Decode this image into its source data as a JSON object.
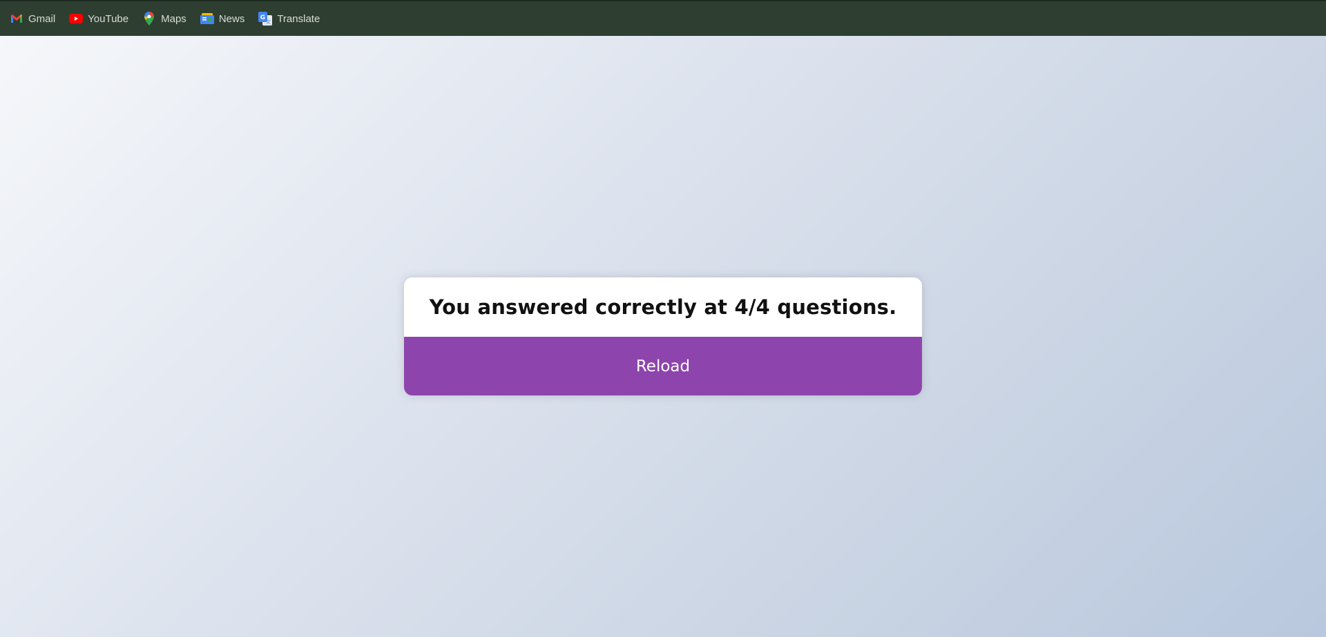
{
  "bookmarks": [
    {
      "label": "Gmail",
      "icon": "gmail-icon"
    },
    {
      "label": "YouTube",
      "icon": "youtube-icon"
    },
    {
      "label": "Maps",
      "icon": "maps-icon"
    },
    {
      "label": "News",
      "icon": "news-icon"
    },
    {
      "label": "Translate",
      "icon": "translate-icon"
    }
  ],
  "quiz": {
    "result_text": "You answered correctly at 4/4 questions.",
    "reload_label": "Reload"
  },
  "colors": {
    "bookmarks_bar": "#2e3f31",
    "button": "#8e44ad",
    "card": "#ffffff"
  }
}
